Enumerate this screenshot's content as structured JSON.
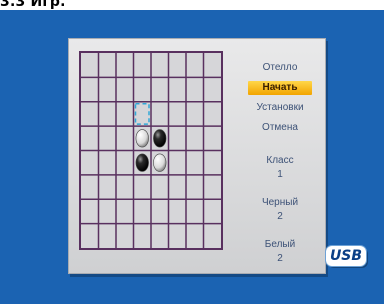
{
  "caption": "3.3 Игр.",
  "game": {
    "title": "Отелло",
    "menu": {
      "start": "Начать",
      "settings": "Установки",
      "cancel": "Отмена"
    },
    "level": {
      "label": "Класс",
      "value": "1"
    },
    "black": {
      "label": "Черный",
      "value": "2"
    },
    "white": {
      "label": "Белый",
      "value": "2"
    },
    "board": {
      "rows": 8,
      "cols": 8,
      "cursor": {
        "row": 2,
        "col": 3
      },
      "pieces": [
        {
          "row": 3,
          "col": 3,
          "color": "white"
        },
        {
          "row": 3,
          "col": 4,
          "color": "black"
        },
        {
          "row": 4,
          "col": 3,
          "color": "black"
        },
        {
          "row": 4,
          "col": 4,
          "color": "white"
        }
      ]
    }
  },
  "badges": {
    "usb": "USB"
  },
  "colors": {
    "screen_bg": "#1b63b2",
    "grid": "#59305f",
    "active_menu": "#f2a400",
    "menu_text": "#3d5277"
  }
}
